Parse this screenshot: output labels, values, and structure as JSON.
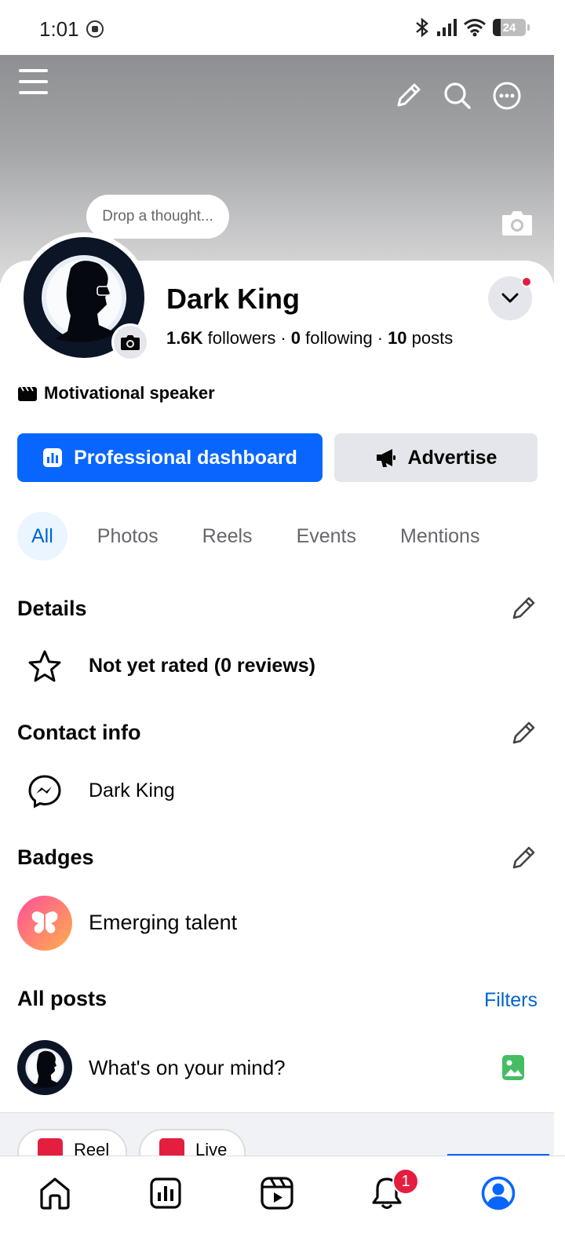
{
  "status_bar": {
    "time": "1:01",
    "battery": "24"
  },
  "cover": {
    "thought_placeholder": "Drop a thought..."
  },
  "profile": {
    "name": "Dark King",
    "followers_count": "1.6K",
    "followers_label": "followers",
    "following_count": "0",
    "following_label": "following",
    "posts_count": "10",
    "posts_label": "posts",
    "bio": "Motivational speaker"
  },
  "actions": {
    "professional_dashboard": "Professional dashboard",
    "advertise": "Advertise"
  },
  "tabs": [
    "All",
    "Photos",
    "Reels",
    "Events",
    "Mentions"
  ],
  "details": {
    "title": "Details",
    "rating": "Not yet rated (0 reviews)"
  },
  "contact": {
    "title": "Contact info",
    "messenger": "Dark King"
  },
  "badges": {
    "title": "Badges",
    "badge": "Emerging talent"
  },
  "posts": {
    "title": "All posts",
    "filters": "Filters",
    "composer_placeholder": "What's on your mind?"
  },
  "composer_chips": [
    "Reel",
    "Live"
  ],
  "bottom_nav": {
    "notifications_badge": "1"
  },
  "colors": {
    "accent": "#0866ff",
    "notification": "#e41e3f"
  }
}
